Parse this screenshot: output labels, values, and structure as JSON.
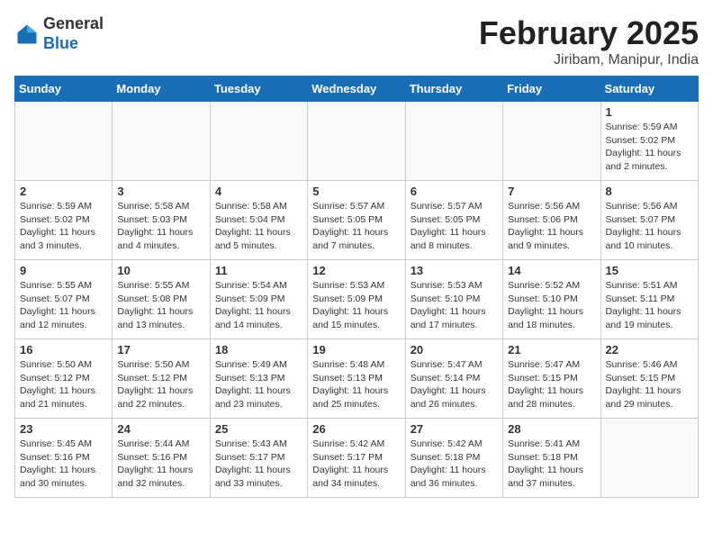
{
  "header": {
    "logo_general": "General",
    "logo_blue": "Blue",
    "month_title": "February 2025",
    "location": "Jiribam, Manipur, India"
  },
  "weekdays": [
    "Sunday",
    "Monday",
    "Tuesday",
    "Wednesday",
    "Thursday",
    "Friday",
    "Saturday"
  ],
  "weeks": [
    [
      {
        "day": "",
        "info": ""
      },
      {
        "day": "",
        "info": ""
      },
      {
        "day": "",
        "info": ""
      },
      {
        "day": "",
        "info": ""
      },
      {
        "day": "",
        "info": ""
      },
      {
        "day": "",
        "info": ""
      },
      {
        "day": "1",
        "info": "Sunrise: 5:59 AM\nSunset: 5:02 PM\nDaylight: 11 hours and 2 minutes."
      }
    ],
    [
      {
        "day": "2",
        "info": "Sunrise: 5:59 AM\nSunset: 5:02 PM\nDaylight: 11 hours and 3 minutes."
      },
      {
        "day": "3",
        "info": "Sunrise: 5:58 AM\nSunset: 5:03 PM\nDaylight: 11 hours and 4 minutes."
      },
      {
        "day": "4",
        "info": "Sunrise: 5:58 AM\nSunset: 5:04 PM\nDaylight: 11 hours and 5 minutes."
      },
      {
        "day": "5",
        "info": "Sunrise: 5:57 AM\nSunset: 5:05 PM\nDaylight: 11 hours and 7 minutes."
      },
      {
        "day": "6",
        "info": "Sunrise: 5:57 AM\nSunset: 5:05 PM\nDaylight: 11 hours and 8 minutes."
      },
      {
        "day": "7",
        "info": "Sunrise: 5:56 AM\nSunset: 5:06 PM\nDaylight: 11 hours and 9 minutes."
      },
      {
        "day": "8",
        "info": "Sunrise: 5:56 AM\nSunset: 5:07 PM\nDaylight: 11 hours and 10 minutes."
      }
    ],
    [
      {
        "day": "9",
        "info": "Sunrise: 5:55 AM\nSunset: 5:07 PM\nDaylight: 11 hours and 12 minutes."
      },
      {
        "day": "10",
        "info": "Sunrise: 5:55 AM\nSunset: 5:08 PM\nDaylight: 11 hours and 13 minutes."
      },
      {
        "day": "11",
        "info": "Sunrise: 5:54 AM\nSunset: 5:09 PM\nDaylight: 11 hours and 14 minutes."
      },
      {
        "day": "12",
        "info": "Sunrise: 5:53 AM\nSunset: 5:09 PM\nDaylight: 11 hours and 15 minutes."
      },
      {
        "day": "13",
        "info": "Sunrise: 5:53 AM\nSunset: 5:10 PM\nDaylight: 11 hours and 17 minutes."
      },
      {
        "day": "14",
        "info": "Sunrise: 5:52 AM\nSunset: 5:10 PM\nDaylight: 11 hours and 18 minutes."
      },
      {
        "day": "15",
        "info": "Sunrise: 5:51 AM\nSunset: 5:11 PM\nDaylight: 11 hours and 19 minutes."
      }
    ],
    [
      {
        "day": "16",
        "info": "Sunrise: 5:50 AM\nSunset: 5:12 PM\nDaylight: 11 hours and 21 minutes."
      },
      {
        "day": "17",
        "info": "Sunrise: 5:50 AM\nSunset: 5:12 PM\nDaylight: 11 hours and 22 minutes."
      },
      {
        "day": "18",
        "info": "Sunrise: 5:49 AM\nSunset: 5:13 PM\nDaylight: 11 hours and 23 minutes."
      },
      {
        "day": "19",
        "info": "Sunrise: 5:48 AM\nSunset: 5:13 PM\nDaylight: 11 hours and 25 minutes."
      },
      {
        "day": "20",
        "info": "Sunrise: 5:47 AM\nSunset: 5:14 PM\nDaylight: 11 hours and 26 minutes."
      },
      {
        "day": "21",
        "info": "Sunrise: 5:47 AM\nSunset: 5:15 PM\nDaylight: 11 hours and 28 minutes."
      },
      {
        "day": "22",
        "info": "Sunrise: 5:46 AM\nSunset: 5:15 PM\nDaylight: 11 hours and 29 minutes."
      }
    ],
    [
      {
        "day": "23",
        "info": "Sunrise: 5:45 AM\nSunset: 5:16 PM\nDaylight: 11 hours and 30 minutes."
      },
      {
        "day": "24",
        "info": "Sunrise: 5:44 AM\nSunset: 5:16 PM\nDaylight: 11 hours and 32 minutes."
      },
      {
        "day": "25",
        "info": "Sunrise: 5:43 AM\nSunset: 5:17 PM\nDaylight: 11 hours and 33 minutes."
      },
      {
        "day": "26",
        "info": "Sunrise: 5:42 AM\nSunset: 5:17 PM\nDaylight: 11 hours and 34 minutes."
      },
      {
        "day": "27",
        "info": "Sunrise: 5:42 AM\nSunset: 5:18 PM\nDaylight: 11 hours and 36 minutes."
      },
      {
        "day": "28",
        "info": "Sunrise: 5:41 AM\nSunset: 5:18 PM\nDaylight: 11 hours and 37 minutes."
      },
      {
        "day": "",
        "info": ""
      }
    ]
  ]
}
